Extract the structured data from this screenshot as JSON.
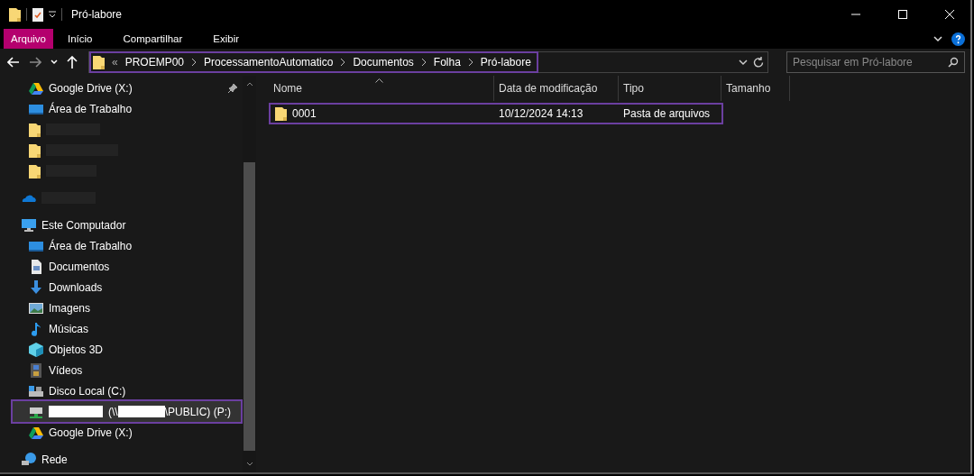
{
  "window": {
    "title": "Pró-labore"
  },
  "ribbon": {
    "tabs": [
      {
        "label": "Arquivo",
        "selected": true
      },
      {
        "label": "Início",
        "selected": false
      },
      {
        "label": "Compartilhar",
        "selected": false
      },
      {
        "label": "Exibir",
        "selected": false
      }
    ]
  },
  "address_bar": {
    "highlighted": true,
    "overflow": "«",
    "crumbs": [
      "PROEMP00",
      "ProcessamentoAutomatico",
      "Documentos",
      "Folha",
      "Pró-labore"
    ]
  },
  "search": {
    "placeholder": "Pesquisar em Pró-labore"
  },
  "sidebar": {
    "items": [
      {
        "kind": "item",
        "label": "Google Drive (X:)",
        "pinned": true,
        "selected": false
      },
      {
        "kind": "item",
        "label": "Área de Trabalho",
        "pinned": false,
        "selected": false
      },
      {
        "kind": "redacted"
      },
      {
        "kind": "redacted"
      },
      {
        "kind": "redacted"
      },
      {
        "kind": "redacted"
      },
      {
        "kind": "item",
        "label": "Este Computador",
        "pinned": false,
        "selected": false
      },
      {
        "kind": "item",
        "label": "Área de Trabalho",
        "pinned": false,
        "selected": false
      },
      {
        "kind": "item",
        "label": "Documentos",
        "pinned": false,
        "selected": false
      },
      {
        "kind": "item",
        "label": "Downloads",
        "pinned": false,
        "selected": false
      },
      {
        "kind": "item",
        "label": "Imagens",
        "pinned": false,
        "selected": false
      },
      {
        "kind": "item",
        "label": "Músicas",
        "pinned": false,
        "selected": false
      },
      {
        "kind": "item",
        "label": "Objetos 3D",
        "pinned": false,
        "selected": false
      },
      {
        "kind": "item",
        "label": "Vídeos",
        "pinned": false,
        "selected": false
      },
      {
        "kind": "item",
        "label": "Disco Local (C:)",
        "pinned": false,
        "selected": false
      },
      {
        "kind": "netdrive",
        "parts": [
          "(\\\\",
          "\\PUBLIC) (P:)"
        ],
        "pinned": false,
        "selected": true
      },
      {
        "kind": "item",
        "label": "Google Drive (X:)",
        "pinned": false,
        "selected": false
      },
      {
        "kind": "item",
        "label": "Rede",
        "pinned": false,
        "selected": false
      }
    ]
  },
  "table": {
    "columns": [
      "Nome",
      "Data de modificação",
      "Tipo",
      "Tamanho"
    ],
    "rows": [
      {
        "name": "0001",
        "modified": "10/12/2024 14:13",
        "type": "Pasta de arquivos",
        "highlighted": true
      }
    ]
  }
}
